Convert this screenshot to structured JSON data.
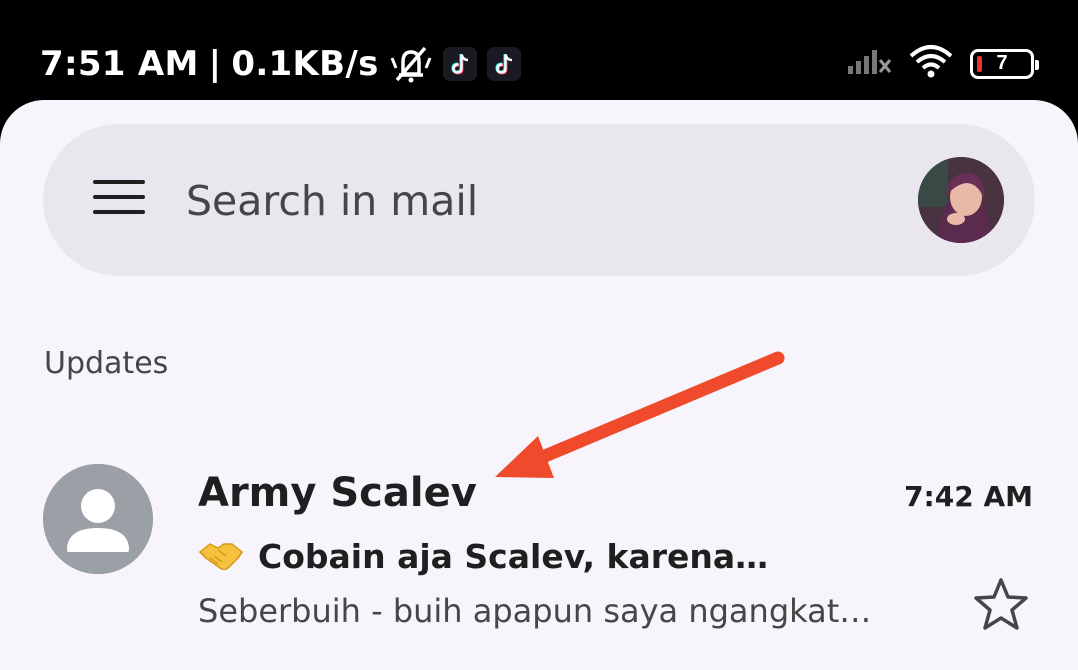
{
  "status_bar": {
    "time": "7:51 AM",
    "separator": "|",
    "network_speed": "0.1KB/s",
    "battery_level": "7",
    "icons": [
      "mute-icon",
      "tiktok-icon",
      "tiktok-icon",
      "signal-icon",
      "wifi-icon",
      "battery-icon"
    ]
  },
  "search": {
    "placeholder": "Search in mail",
    "menu_icon": "menu-icon",
    "account_icon": "avatar"
  },
  "section": {
    "label": "Updates"
  },
  "mail": {
    "sender": "Army Scalev",
    "time": "7:42 AM",
    "subject_emoji": "handshake-icon",
    "subject": "Cobain aja Scalev, karena…",
    "snippet": "Seberbuih - buih apapun saya ngangkat…",
    "starred": false
  },
  "annotation": {
    "type": "arrow",
    "color": "#ef4a2b"
  }
}
